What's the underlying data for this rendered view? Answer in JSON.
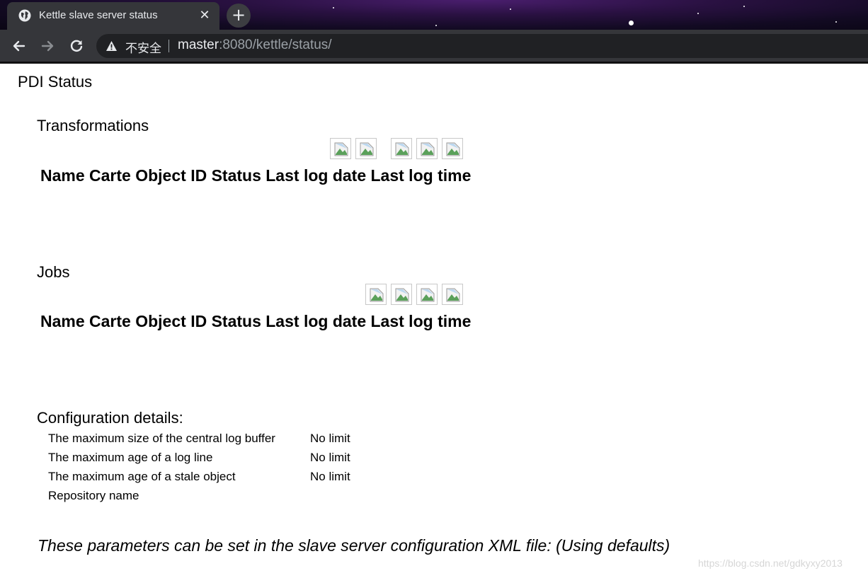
{
  "browser": {
    "tab_title": "Kettle slave server status",
    "security_label": "不安全",
    "url_host": "master",
    "url_rest": ":8080/kettle/status/"
  },
  "page": {
    "title": "PDI Status",
    "transformations": {
      "heading": "Transformations",
      "table_header": "Name Carte Object ID Status Last log date Last log time"
    },
    "jobs": {
      "heading": "Jobs",
      "table_header": "Name Carte Object ID Status Last log date Last log time"
    },
    "config": {
      "heading": "Configuration details:",
      "rows": [
        {
          "label": "The maximum size of the central log buffer",
          "value": "No limit"
        },
        {
          "label": "The maximum age of a log line",
          "value": "No limit"
        },
        {
          "label": "The maximum age of a stale object",
          "value": "No limit"
        },
        {
          "label": "Repository name",
          "value": ""
        }
      ]
    },
    "footer_note": "These parameters can be set in the slave server configuration XML file: (Using defaults)"
  },
  "watermark": "https://blog.csdn.net/gdkyxy2013",
  "icons": {
    "tab": "globe-icon",
    "tab_close": "close-icon",
    "new_tab": "plus-icon",
    "back": "back-arrow-icon",
    "forward": "forward-arrow-icon",
    "reload": "reload-icon",
    "security": "warning-icon",
    "toolbar_images": "broken-image-icon"
  },
  "colors": {
    "chrome_bg": "#35363a",
    "omnibox_bg": "#202124",
    "chrome_text": "#e8eaed",
    "url_dim": "#9aa0a6"
  }
}
